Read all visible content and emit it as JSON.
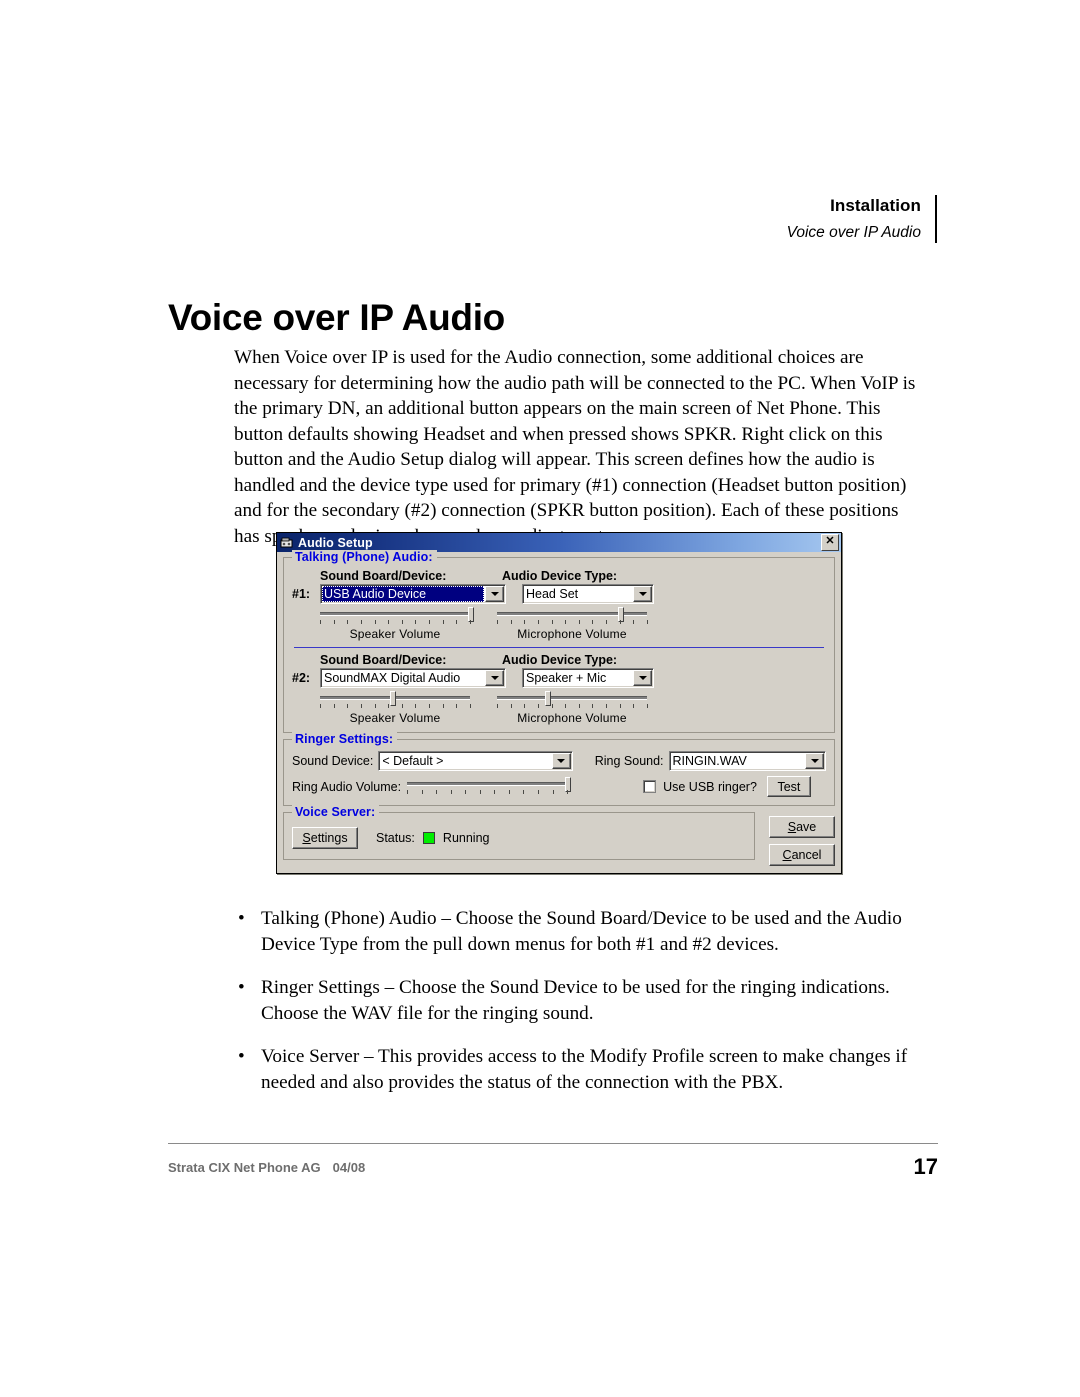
{
  "header": {
    "section": "Installation",
    "subsection": "Voice over IP Audio"
  },
  "title": "Voice over IP Audio",
  "paragraph": "When Voice over IP is used for the Audio connection, some additional choices are necessary for determining how the audio path will be connected to the PC. When VoIP is the primary DN, an additional button appears on the main screen of Net Phone. This button defaults showing Headset and when pressed shows SPKR. Right click on this button and the Audio Setup dialog will appear. This screen defines how the audio is handled and the device type used for primary (#1) connection (Headset button position) and for the secondary (#2) connection (SPKR button position). Each of these positions has speaker and microphone volume adjustments.",
  "dialog": {
    "title": "Audio Setup",
    "icon": "audio-setup-icon",
    "close_label": "✕",
    "talking_group": {
      "legend": "Talking (Phone) Audio:",
      "col1_label": "Sound Board/Device:",
      "col2_label": "Audio Device Type:",
      "rows": [
        {
          "index": "#1:",
          "sound_board": "USB Audio Device",
          "sound_board_selected": true,
          "device_type": "Head Set",
          "speaker_label": "Speaker  Volume",
          "speaker_value": 100,
          "mic_label": "Microphone  Volume",
          "mic_value": 82
        },
        {
          "index": "#2:",
          "sound_board": "SoundMAX Digital Audio",
          "sound_board_selected": false,
          "device_type": "Speaker + Mic",
          "speaker_label": "Speaker  Volume",
          "speaker_value": 48,
          "mic_label": "Microphone  Volume",
          "mic_value": 33
        }
      ]
    },
    "ringer_group": {
      "legend": "Ringer Settings:",
      "sound_device_label": "Sound Device:",
      "sound_device_value": "< Default >",
      "ring_sound_label": "Ring Sound:",
      "ring_sound_value": "RINGIN.WAV",
      "ring_volume_label": "Ring Audio Volume:",
      "ring_volume_value": 100,
      "usb_ringer_label": "Use USB ringer?",
      "usb_ringer_checked": false,
      "test_button": "Test"
    },
    "voice_server_group": {
      "legend": "Voice Server:",
      "settings_button_prefix": "S",
      "settings_button_rest": "ettings",
      "status_label": "Status:",
      "status_value": "Running",
      "status_color": "#00ee00"
    },
    "buttons": {
      "save_prefix": "S",
      "save_rest": "ave",
      "cancel_prefix": "C",
      "cancel_rest": "ancel"
    }
  },
  "bullets": [
    "Talking (Phone) Audio – Choose the Sound Board/Device to be used and the Audio Device Type from the pull down menus for both #1 and #2 devices.",
    "Ringer Settings – Choose the Sound Device to be used for the ringing indications. Choose the WAV file for the ringing sound.",
    "Voice Server – This provides access to the Modify Profile screen to make changes if needed and also provides the status of the connection with the PBX."
  ],
  "bullet_marker": "•",
  "footer": {
    "doc_name": "Strata CIX Net Phone AG",
    "date": "04/08",
    "page_number": "17"
  }
}
